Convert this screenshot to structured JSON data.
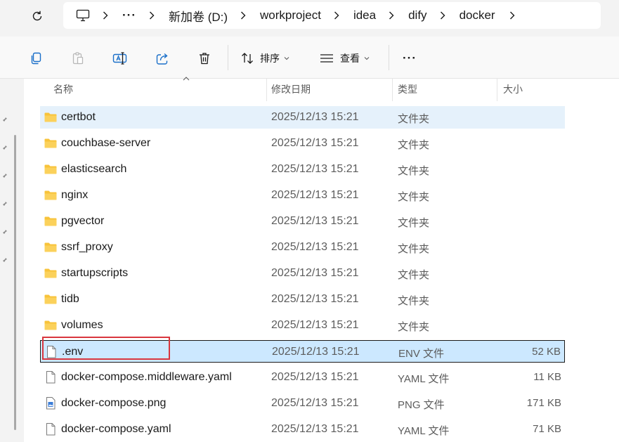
{
  "breadcrumb": {
    "overflow": "···",
    "items": [
      "新加卷 (D:)",
      "workproject",
      "idea",
      "dify",
      "docker"
    ]
  },
  "toolbar": {
    "sort_label": "排序",
    "view_label": "查看",
    "more_label": "···"
  },
  "columns": {
    "name": "名称",
    "modified": "修改日期",
    "type": "类型",
    "size": "大小"
  },
  "files": [
    {
      "name": "certbot",
      "date": "2025/12/13 15:21",
      "type": "文件夹",
      "size": "",
      "icon": "folder-icon",
      "state": "hover"
    },
    {
      "name": "couchbase-server",
      "date": "2025/12/13 15:21",
      "type": "文件夹",
      "size": "",
      "icon": "folder-icon"
    },
    {
      "name": "elasticsearch",
      "date": "2025/12/13 15:21",
      "type": "文件夹",
      "size": "",
      "icon": "folder-icon"
    },
    {
      "name": "nginx",
      "date": "2025/12/13 15:21",
      "type": "文件夹",
      "size": "",
      "icon": "folder-icon"
    },
    {
      "name": "pgvector",
      "date": "2025/12/13 15:21",
      "type": "文件夹",
      "size": "",
      "icon": "folder-icon"
    },
    {
      "name": "ssrf_proxy",
      "date": "2025/12/13 15:21",
      "type": "文件夹",
      "size": "",
      "icon": "folder-icon"
    },
    {
      "name": "startupscripts",
      "date": "2025/12/13 15:21",
      "type": "文件夹",
      "size": "",
      "icon": "folder-icon"
    },
    {
      "name": "tidb",
      "date": "2025/12/13 15:21",
      "type": "文件夹",
      "size": "",
      "icon": "folder-icon"
    },
    {
      "name": "volumes",
      "date": "2025/12/13 15:21",
      "type": "文件夹",
      "size": "",
      "icon": "folder-icon"
    },
    {
      "name": ".env",
      "date": "2025/12/13 15:21",
      "type": "ENV 文件",
      "size": "52 KB",
      "icon": "file-icon",
      "state": "selected"
    },
    {
      "name": "docker-compose.middleware.yaml",
      "date": "2025/12/13 15:21",
      "type": "YAML 文件",
      "size": "11 KB",
      "icon": "file-icon"
    },
    {
      "name": "docker-compose.png",
      "date": "2025/12/13 15:21",
      "type": "PNG 文件",
      "size": "171 KB",
      "icon": "image-file-icon"
    },
    {
      "name": "docker-compose.yaml",
      "date": "2025/12/13 15:21",
      "type": "YAML 文件",
      "size": "71 KB",
      "icon": "file-icon"
    }
  ],
  "colors": {
    "selected_bg": "#cce8ff",
    "hover_bg": "#e5f1fb",
    "folder": "#f8c33a",
    "highlight_box": "#d9363e"
  }
}
